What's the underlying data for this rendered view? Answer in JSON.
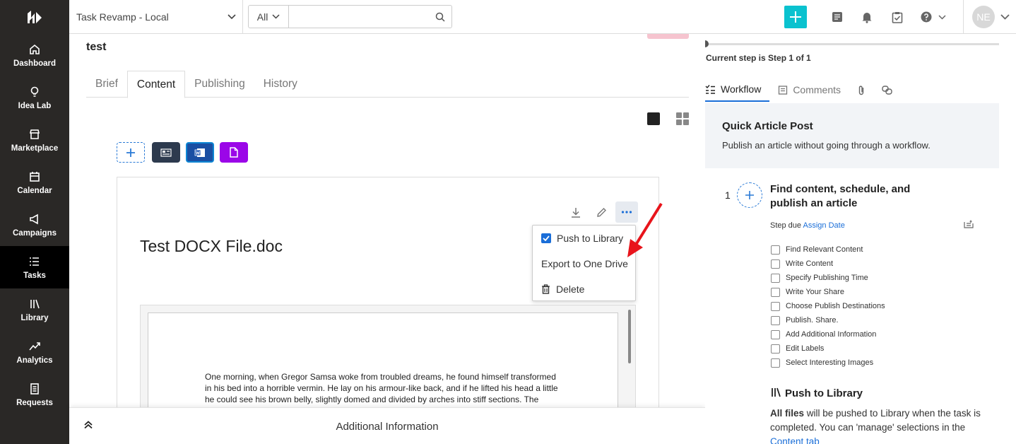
{
  "sidebar": {
    "items": [
      {
        "label": "Dashboard",
        "icon": "home-icon"
      },
      {
        "label": "Idea Lab",
        "icon": "lightbulb-icon"
      },
      {
        "label": "Marketplace",
        "icon": "store-icon"
      },
      {
        "label": "Calendar",
        "icon": "calendar-icon"
      },
      {
        "label": "Campaigns",
        "icon": "megaphone-icon"
      },
      {
        "label": "Tasks",
        "icon": "list-icon"
      },
      {
        "label": "Library",
        "icon": "library-icon"
      },
      {
        "label": "Analytics",
        "icon": "trend-icon"
      },
      {
        "label": "Requests",
        "icon": "document-icon"
      }
    ],
    "active": "Tasks"
  },
  "topbar": {
    "project": "Task Revamp - Local",
    "search_scope": "All",
    "search_value": "",
    "avatar_initials": "NE",
    "accent_color": "#0ac2cf"
  },
  "main": {
    "task_title": "test",
    "tabs": [
      {
        "label": "Brief"
      },
      {
        "label": "Content"
      },
      {
        "label": "Publishing"
      },
      {
        "label": "History"
      }
    ],
    "active_tab": "Content",
    "doc_title": "Test DOCX File.doc",
    "doc_text": "One morning, when Gregor Samsa woke from troubled dreams, he found himself transformed in his bed into a horrible vermin. He lay on his armour-like back, and if he lifted his head a little he could see his brown belly, slightly domed and divided by arches into stiff sections. The bedding was hardly able to cover it and seemed ready to slide off any moment.",
    "menu": {
      "push_to_library": "Push to Library",
      "export_one_drive": "Export to One Drive",
      "delete": "Delete"
    },
    "bottom_label": "Additional Information"
  },
  "right": {
    "step_label": "Current step is Step 1 of 1",
    "tabs": [
      {
        "label": "Workflow"
      },
      {
        "label": "Comments"
      }
    ],
    "workflow_title": "Quick Article Post",
    "workflow_desc": "Publish an article without going through a workflow.",
    "step_number": "1",
    "step_title": "Find content, schedule, and publish an article",
    "step_due_label": "Step due",
    "step_due_link": "Assign Date",
    "checklist": [
      "Find Relevant Content",
      "Write Content",
      "Specify Publishing Time",
      "Write Your Share",
      "Choose Publish Destinations",
      "Publish. Share.",
      "Add Additional Information",
      "Edit Labels",
      "Select Interesting Images"
    ],
    "ptl_title": "Push to Library",
    "ptl_desc_bold": "All files",
    "ptl_desc_rest": " will be pushed to Library when the task is completed. You can 'manage' selections in the ",
    "ptl_desc_link": "Content tab"
  }
}
